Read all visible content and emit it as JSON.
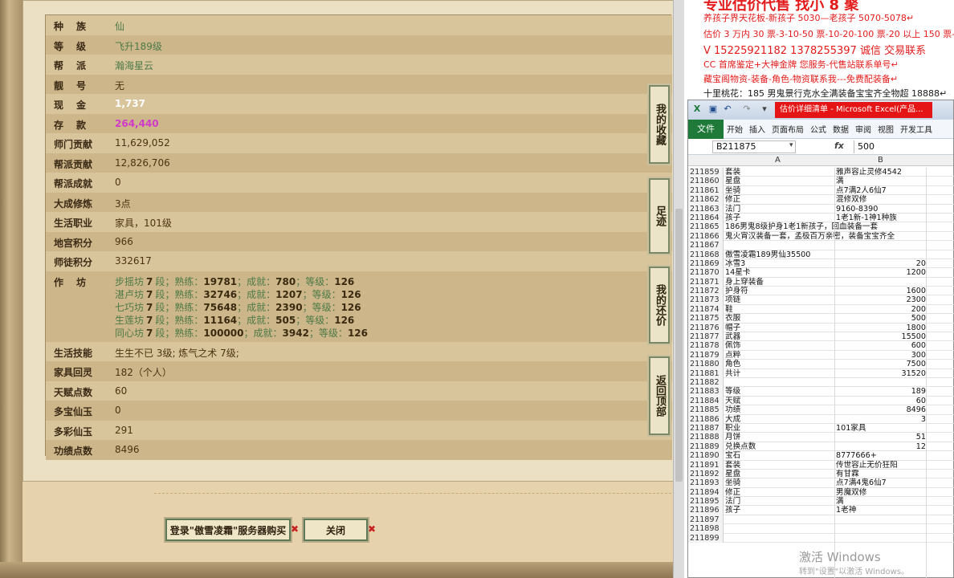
{
  "stats": [
    {
      "label": "种族",
      "value": "仙",
      "spread": true,
      "style": "green"
    },
    {
      "label": "等级",
      "value": "飞升189级",
      "spread": true,
      "style": "green"
    },
    {
      "label": "帮派",
      "value": "瀚海星云",
      "spread": true,
      "style": "green"
    },
    {
      "label": "靓号",
      "value": "无",
      "spread": true,
      "style": "brown"
    },
    {
      "label": "现金",
      "value": "1,737",
      "spread": true,
      "style": "white"
    },
    {
      "label": "存款",
      "value": "264,440",
      "spread": true,
      "style": "pink"
    },
    {
      "label": "师门贡献",
      "value": "11,629,052",
      "style": "brown"
    },
    {
      "label": "帮派贡献",
      "value": "12,826,706",
      "style": "brown"
    },
    {
      "label": "帮派成就",
      "value": "0",
      "style": "brown"
    },
    {
      "label": "大成修炼",
      "value": "3点",
      "style": "brown"
    },
    {
      "label": "生活职业",
      "value": "家具，101级",
      "style": "brown"
    },
    {
      "label": "地宫积分",
      "value": "966",
      "style": "brown"
    },
    {
      "label": "师徒积分",
      "value": "332617",
      "style": "brown"
    }
  ],
  "workshop": {
    "label": "作坊",
    "lines": [
      {
        "name": "步摇坊",
        "lv": "7",
        "seg": "段；熟练：",
        "exp": "19781",
        "ach_lbl": "；成就：",
        "ach": "780",
        "grade_lbl": "；等级：",
        "grade": "126"
      },
      {
        "name": "湛卢坊",
        "lv": "7",
        "seg": "段；熟练：",
        "exp": "32746",
        "ach_lbl": "；成就：",
        "ach": "1207",
        "grade_lbl": "；等级：",
        "grade": "126"
      },
      {
        "name": "七巧坊",
        "lv": "7",
        "seg": "段；熟练：",
        "exp": "75648",
        "ach_lbl": "；成就：",
        "ach": "2390",
        "grade_lbl": "；等级：",
        "grade": "126"
      },
      {
        "name": "生莲坊",
        "lv": "7",
        "seg": "段；熟练：",
        "exp": "11164",
        "ach_lbl": "；成就：",
        "ach": "505",
        "grade_lbl": "；等级：",
        "grade": "126"
      },
      {
        "name": "同心坊",
        "lv": "7",
        "seg": "段；熟练：",
        "exp": "100000",
        "ach_lbl": "；成就：",
        "ach": "3942",
        "grade_lbl": "；等级：",
        "grade": "126"
      }
    ]
  },
  "stats2": [
    {
      "label": "生活技能",
      "value": "生生不已 3级; 炼气之术 7级;",
      "style": "brown"
    },
    {
      "label": "家具回灵",
      "value": "182（个人）",
      "style": "brown"
    },
    {
      "label": "天赋点数",
      "value": "60",
      "style": "brown"
    },
    {
      "label": "多宝仙玉",
      "value": "0",
      "style": "brown"
    },
    {
      "label": "多彩仙玉",
      "value": "291",
      "style": "brown"
    },
    {
      "label": "功绩点数",
      "value": "8496",
      "style": "brown"
    }
  ],
  "side_buttons": [
    "我的收藏",
    "足迹",
    "我的还价",
    "返回顶部"
  ],
  "buttons": {
    "login_buy": "登录\"傲雪凌霜\"服务器购买",
    "close": "关闭",
    "x": "✖"
  },
  "notes": [
    {
      "text": "专业估价代售 找小 8 聚",
      "big": true
    },
    {
      "text": "养孩子界天花板-新孩子 5030—老孩子 5070-5078↵"
    },
    {
      "text": "估价 3 万内 30 票-3-10-50 票-10-20-100 票-20 以上 150 票-1 票"
    },
    {
      "text": "V 15225921182    1378255397    诚信 交易联系",
      "big": true
    },
    {
      "text": "CC 首席鉴定+大神金牌      您服务-代售站联系单号↵"
    },
    {
      "text": "藏宝阁物资-装备-角色-物资联系我---免费配装备↵"
    },
    {
      "text": "十里桃花：185 男鬼景行克水全满装备宝宝齐全物超 18888↵",
      "dark": true
    }
  ],
  "excel": {
    "title": "估价详细清单 - Microsoft Excel(产品...",
    "tabs": [
      "开始",
      "插入",
      "页面布局",
      "公式",
      "数据",
      "审阅",
      "视图",
      "开发工具"
    ],
    "file_tab": "文件",
    "name_box": "B211875",
    "fx": "fx",
    "formula_value": "500",
    "col_a": "A",
    "col_b": "B",
    "rows": [
      {
        "n": "211859",
        "a": "套装",
        "b": "雅声容止灵修4542"
      },
      {
        "n": "211860",
        "a": "星盘",
        "b": "满"
      },
      {
        "n": "211861",
        "a": "坐骑",
        "b": "点7满2人6仙7"
      },
      {
        "n": "211862",
        "a": "修正",
        "b": "混修双修"
      },
      {
        "n": "211863",
        "a": "法门",
        "b": "9160-8390"
      },
      {
        "n": "211864",
        "a": "孩子",
        "b": "1老1新-1神1种族"
      },
      {
        "n": "211865",
        "a": "186男鬼8级护身1老1新孩子，回血装备一套",
        "b": ""
      },
      {
        "n": "211866",
        "a": "鬼火宵汉装备一套，孟极百万亲密，装备宝宝齐全",
        "b": ""
      },
      {
        "n": "211867",
        "a": "",
        "b": ""
      },
      {
        "n": "211868",
        "a": "傲雪凌霜189男仙35500",
        "b": ""
      },
      {
        "n": "211869",
        "a": "冰雪3",
        "bn": "20"
      },
      {
        "n": "211870",
        "a": "14星卡",
        "bn": "1200"
      },
      {
        "n": "211871",
        "a": "身上穿装备",
        "b": ""
      },
      {
        "n": "211872",
        "a": "护身符",
        "bn": "1600"
      },
      {
        "n": "211873",
        "a": "项链",
        "bn": "2300"
      },
      {
        "n": "211874",
        "a": "鞋",
        "bn": "200"
      },
      {
        "n": "211875",
        "a": "衣服",
        "bn": "500"
      },
      {
        "n": "211876",
        "a": "帽子",
        "bn": "1800"
      },
      {
        "n": "211877",
        "a": "武器",
        "bn": "15500"
      },
      {
        "n": "211878",
        "a": "佩饰",
        "bn": "600"
      },
      {
        "n": "211879",
        "a": "点粹",
        "bn": "300"
      },
      {
        "n": "211880",
        "a": "角色",
        "bn": "7500"
      },
      {
        "n": "211881",
        "a": "共计",
        "bn": "31520"
      },
      {
        "n": "211882",
        "a": "",
        "b": ""
      },
      {
        "n": "211883",
        "a": "等级",
        "bn": "189"
      },
      {
        "n": "211884",
        "a": "天赋",
        "bn": "60"
      },
      {
        "n": "211885",
        "a": "功绩",
        "bn": "8496"
      },
      {
        "n": "211886",
        "a": "大成",
        "bn": "3"
      },
      {
        "n": "211887",
        "a": "职业",
        "b": "101家具"
      },
      {
        "n": "211888",
        "a": "月饼",
        "bn": "51"
      },
      {
        "n": "211889",
        "a": "兑换点数",
        "bn": "12"
      },
      {
        "n": "211890",
        "a": "宝石",
        "b": "8777666+"
      },
      {
        "n": "211891",
        "a": "套装",
        "b": "传世容止无价狂阳"
      },
      {
        "n": "211892",
        "a": "星盘",
        "b": "有甘霖"
      },
      {
        "n": "211893",
        "a": "坐骑",
        "b": "点7满4鬼6仙7"
      },
      {
        "n": "211894",
        "a": "修正",
        "b": "男魔双修"
      },
      {
        "n": "211895",
        "a": "法门",
        "b": "满"
      },
      {
        "n": "211896",
        "a": "孩子",
        "b": "1老神"
      },
      {
        "n": "211897",
        "a": "",
        "b": ""
      },
      {
        "n": "211898",
        "a": "",
        "b": ""
      },
      {
        "n": "211899",
        "a": "",
        "b": ""
      }
    ],
    "watermark": "激活 Windows",
    "watermark_sub": "转到\"设置\"以激活 Windows。"
  }
}
